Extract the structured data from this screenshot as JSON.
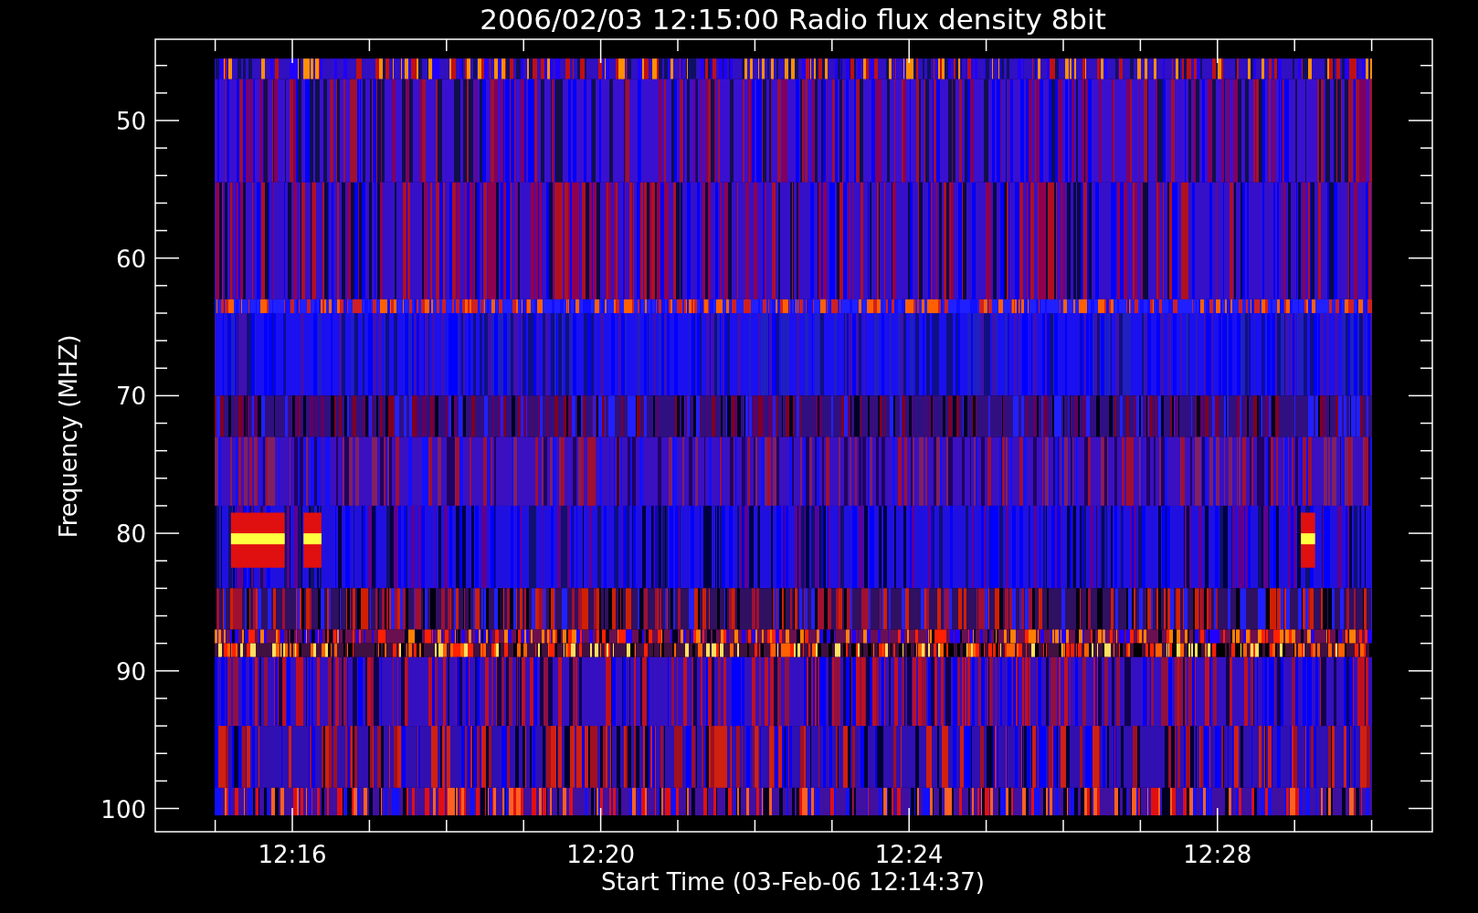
{
  "title": "2006/02/03 12:15:00 Radio flux density 8bit",
  "y_axis": {
    "label": "Frequency (MHZ)",
    "ticks": [
      "50",
      "60",
      "70",
      "80",
      "90",
      "100"
    ]
  },
  "x_axis": {
    "label": "Start Time (03-Feb-06 12:14:37)",
    "ticks": [
      "12:16",
      "12:20",
      "12:24",
      "12:28"
    ]
  }
}
